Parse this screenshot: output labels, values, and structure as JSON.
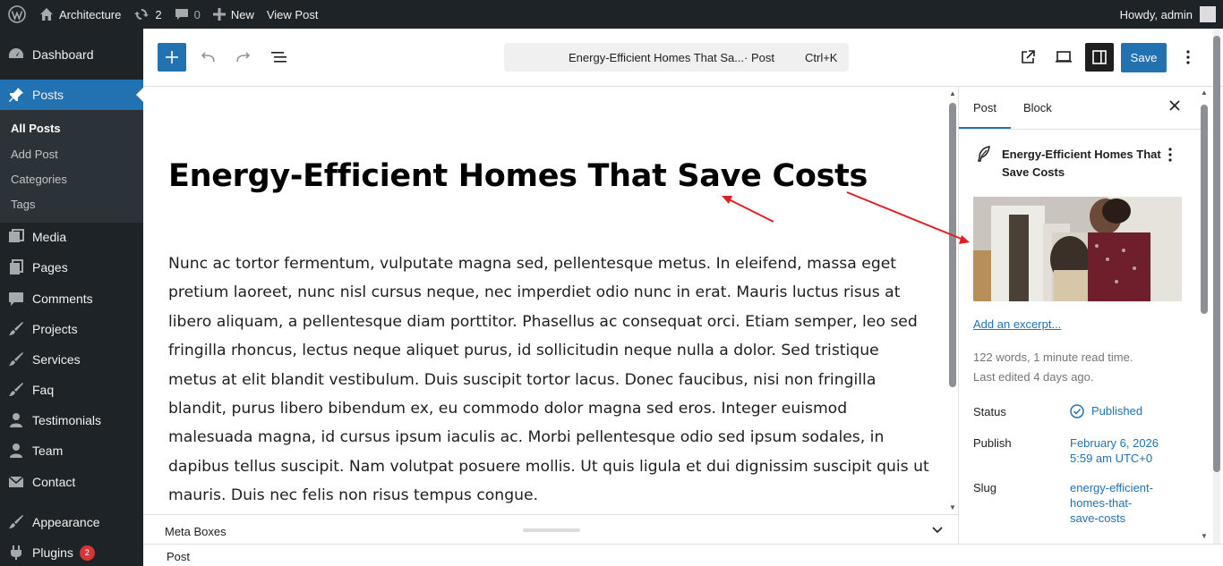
{
  "adminbar": {
    "site_name": "Architecture",
    "updates_count": "2",
    "comments_count": "0",
    "new_label": "New",
    "view_post_label": "View Post",
    "howdy": "Howdy, admin"
  },
  "sidebar": {
    "items": [
      {
        "label": "Dashboard",
        "icon": "dashboard-icon"
      },
      {
        "label": "Posts",
        "icon": "pushpin-icon"
      },
      {
        "label": "Media",
        "icon": "media-icon"
      },
      {
        "label": "Pages",
        "icon": "pages-icon"
      },
      {
        "label": "Comments",
        "icon": "comment-icon"
      },
      {
        "label": "Projects",
        "icon": "brush-icon"
      },
      {
        "label": "Services",
        "icon": "brush-icon"
      },
      {
        "label": "Faq",
        "icon": "brush-icon"
      },
      {
        "label": "Testimonials",
        "icon": "user-icon"
      },
      {
        "label": "Team",
        "icon": "user-icon"
      },
      {
        "label": "Contact",
        "icon": "email-icon"
      },
      {
        "label": "Appearance",
        "icon": "appearance-icon"
      },
      {
        "label": "Plugins",
        "icon": "plugins-icon",
        "badge": "2"
      }
    ],
    "submenu": [
      "All Posts",
      "Add Post",
      "Categories",
      "Tags"
    ]
  },
  "header": {
    "doc_title": "Energy-Efficient Homes That Sa...",
    "doc_type": "· Post",
    "shortcut": "Ctrl+K",
    "save_label": "Save"
  },
  "post": {
    "title": "Energy-Efficient Homes That Save Costs",
    "body": "Nunc ac tortor fermentum, vulputate magna sed, pellentesque metus. In eleifend, massa eget pretium laoreet, nunc nisl cursus neque, nec imperdiet odio nunc in erat. Mauris luctus risus at libero aliquam, a pellentesque diam porttitor. Phasellus ac consequat orci. Etiam semper, leo sed fringilla rhoncus, lectus neque aliquet purus, id sollicitudin neque nulla a dolor. Sed tristique metus at elit blandit vestibulum. Duis suscipit tortor lacus. Donec faucibus, nisi non fringilla blandit, purus libero bibendum ex, eu commodo dolor magna sed eros. Integer euismod malesuada magna, id cursus ipsum iaculis ac. Morbi pellentesque odio sed ipsum sodales, in dapibus tellus suscipit. Nam volutpat posuere mollis. Ut quis ligula et dui dignissim suscipit quis ut mauris. Duis nec felis non risus tempus congue."
  },
  "metaboxes": {
    "label": "Meta Boxes"
  },
  "footer": {
    "breadcrumb": "Post"
  },
  "settings": {
    "tabs": [
      "Post",
      "Block"
    ],
    "post_title": "Energy-Efficient Homes That Save Costs",
    "excerpt_link": "Add an excerpt...",
    "words": "122 words, 1 minute read time.",
    "last_edited": "Last edited 4 days ago.",
    "status_label": "Status",
    "status_value": "Published",
    "publish_label": "Publish",
    "publish_date": "February 6, 2026",
    "publish_time": "5:59 am UTC+0",
    "slug_label": "Slug",
    "slug_line1": "energy-efficient-",
    "slug_line2": "homes-that-",
    "slug_line3": "save-costs"
  },
  "colors": {
    "admin_dark": "#1d2327",
    "accent": "#2271b1",
    "badge": "#d63638",
    "annotation_arrow": "#e02020"
  }
}
